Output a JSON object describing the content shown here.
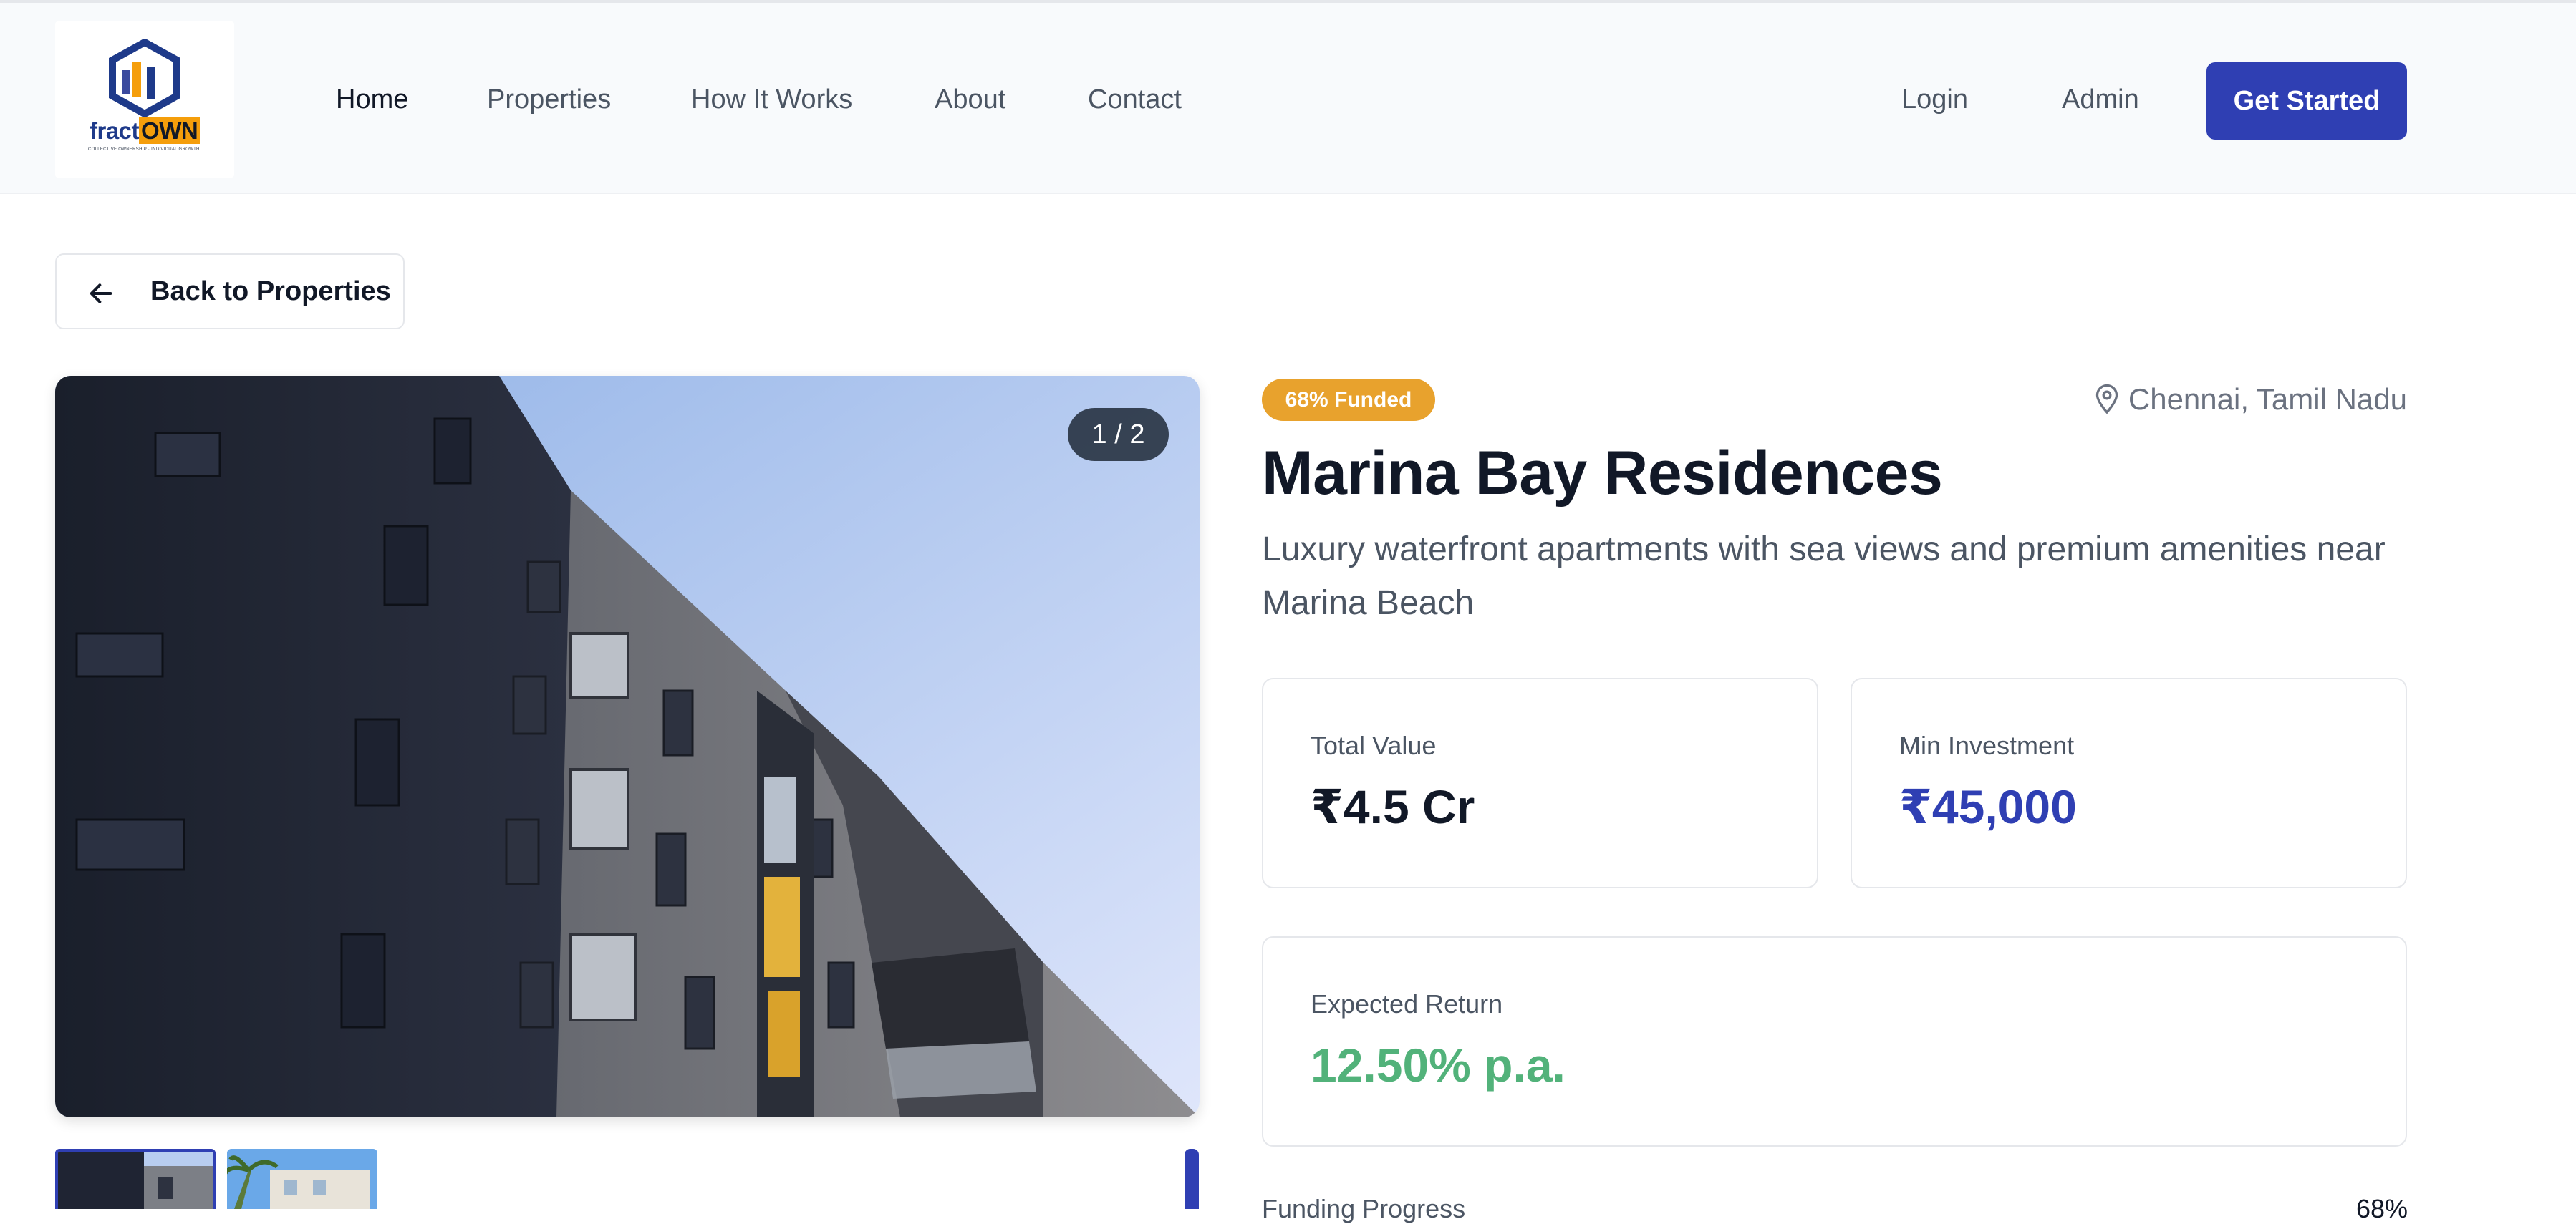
{
  "header": {
    "logo": {
      "word_a": "fract",
      "word_b": "OWN",
      "tagline": "COLLECTIVE OWNERSHIP · INDIVIDUAL GROWTH"
    },
    "nav": [
      {
        "label": "Home",
        "active": true
      },
      {
        "label": "Properties",
        "active": false
      },
      {
        "label": "How It Works",
        "active": false
      },
      {
        "label": "About",
        "active": false
      },
      {
        "label": "Contact",
        "active": false
      }
    ],
    "login_label": "Login",
    "admin_label": "Admin",
    "cta_label": "Get Started"
  },
  "back_button": {
    "label": "Back to Properties",
    "icon": "arrow-left-icon"
  },
  "gallery": {
    "counter": "1 / 2"
  },
  "property": {
    "funded_badge": "68% Funded",
    "location": "Chennai, Tamil Nadu",
    "location_icon": "map-pin-icon",
    "title": "Marina Bay Residences",
    "description": "Luxury waterfront apartments with sea views and premium amenities near Marina Beach",
    "stats": {
      "total_value_label": "Total Value",
      "total_value": "₹4.5 Cr",
      "min_investment_label": "Min Investment",
      "min_investment": "₹45,000",
      "expected_return_label": "Expected Return",
      "expected_return": "12.50% p.a."
    },
    "funding_progress_label": "Funding Progress",
    "funding_progress_value": "68%"
  },
  "colors": {
    "primary": "#2f3fb3",
    "badge": "#e8a22d",
    "return_green": "#52b27a"
  }
}
